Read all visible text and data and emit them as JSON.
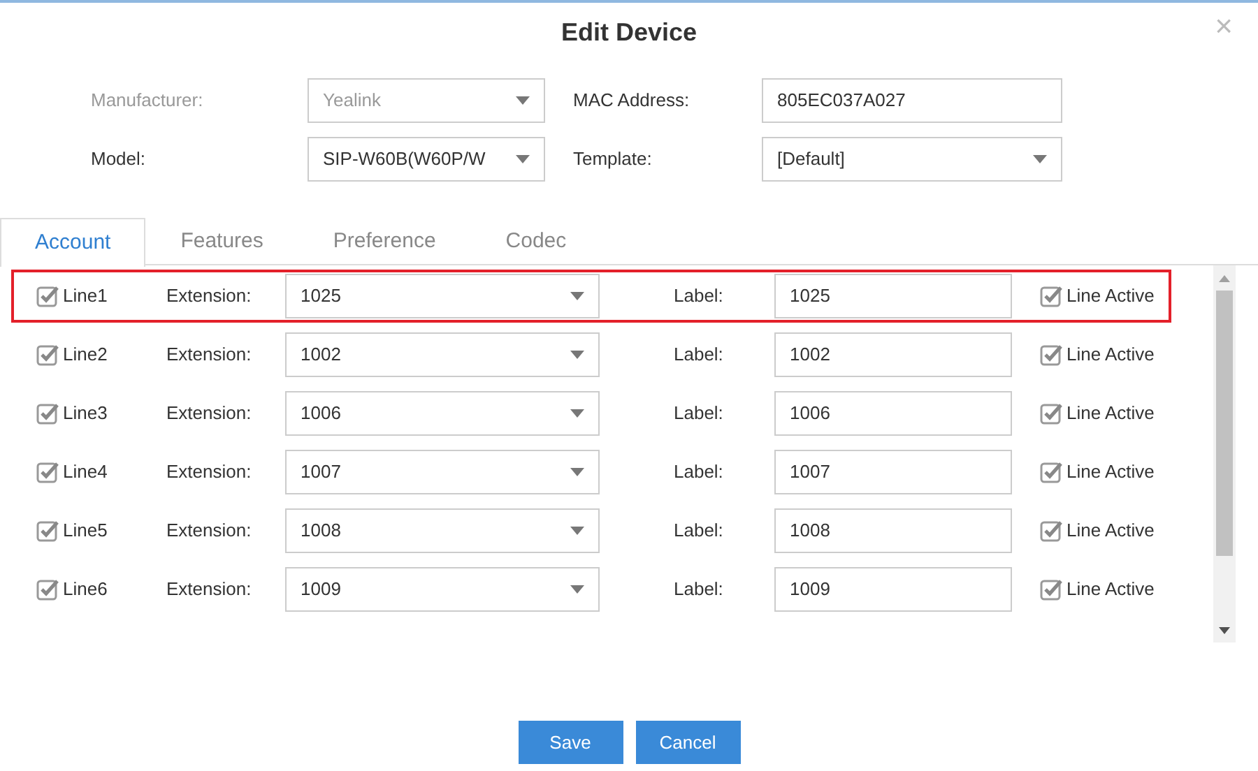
{
  "dialog": {
    "title": "Edit Device",
    "close": "×"
  },
  "form": [
    {
      "label": "Manufacturer:",
      "kind": "select",
      "value": "Yealink",
      "disabled": true
    },
    {
      "label": "MAC Address:",
      "kind": "text",
      "value": "805EC037A027",
      "disabled": false
    },
    {
      "label": "Model:",
      "kind": "select",
      "value": "SIP-W60B(W60P/W",
      "disabled": false
    },
    {
      "label": "Template:",
      "kind": "select",
      "value": "[Default]",
      "disabled": false
    }
  ],
  "tabs": [
    {
      "label": "Account",
      "selected": true
    },
    {
      "label": "Features",
      "selected": false
    },
    {
      "label": "Preference",
      "selected": false
    },
    {
      "label": "Codec",
      "selected": false
    }
  ],
  "lines": [
    {
      "name": "Line1",
      "checked": true,
      "extension_label": "Extension:",
      "extension": "1025",
      "label_label": "Label:",
      "label": "1025",
      "active_label": "Line Active",
      "active": true,
      "highlighted": true
    },
    {
      "name": "Line2",
      "checked": true,
      "extension_label": "Extension:",
      "extension": "1002",
      "label_label": "Label:",
      "label": "1002",
      "active_label": "Line Active",
      "active": true,
      "highlighted": false
    },
    {
      "name": "Line3",
      "checked": true,
      "extension_label": "Extension:",
      "extension": "1006",
      "label_label": "Label:",
      "label": "1006",
      "active_label": "Line Active",
      "active": true,
      "highlighted": false
    },
    {
      "name": "Line4",
      "checked": true,
      "extension_label": "Extension:",
      "extension": "1007",
      "label_label": "Label:",
      "label": "1007",
      "active_label": "Line Active",
      "active": true,
      "highlighted": false
    },
    {
      "name": "Line5",
      "checked": true,
      "extension_label": "Extension:",
      "extension": "1008",
      "label_label": "Label:",
      "label": "1008",
      "active_label": "Line Active",
      "active": true,
      "highlighted": false
    },
    {
      "name": "Line6",
      "checked": true,
      "extension_label": "Extension:",
      "extension": "1009",
      "label_label": "Label:",
      "label": "1009",
      "active_label": "Line Active",
      "active": true,
      "highlighted": false
    }
  ],
  "buttons": [
    "Save",
    "Cancel"
  ]
}
